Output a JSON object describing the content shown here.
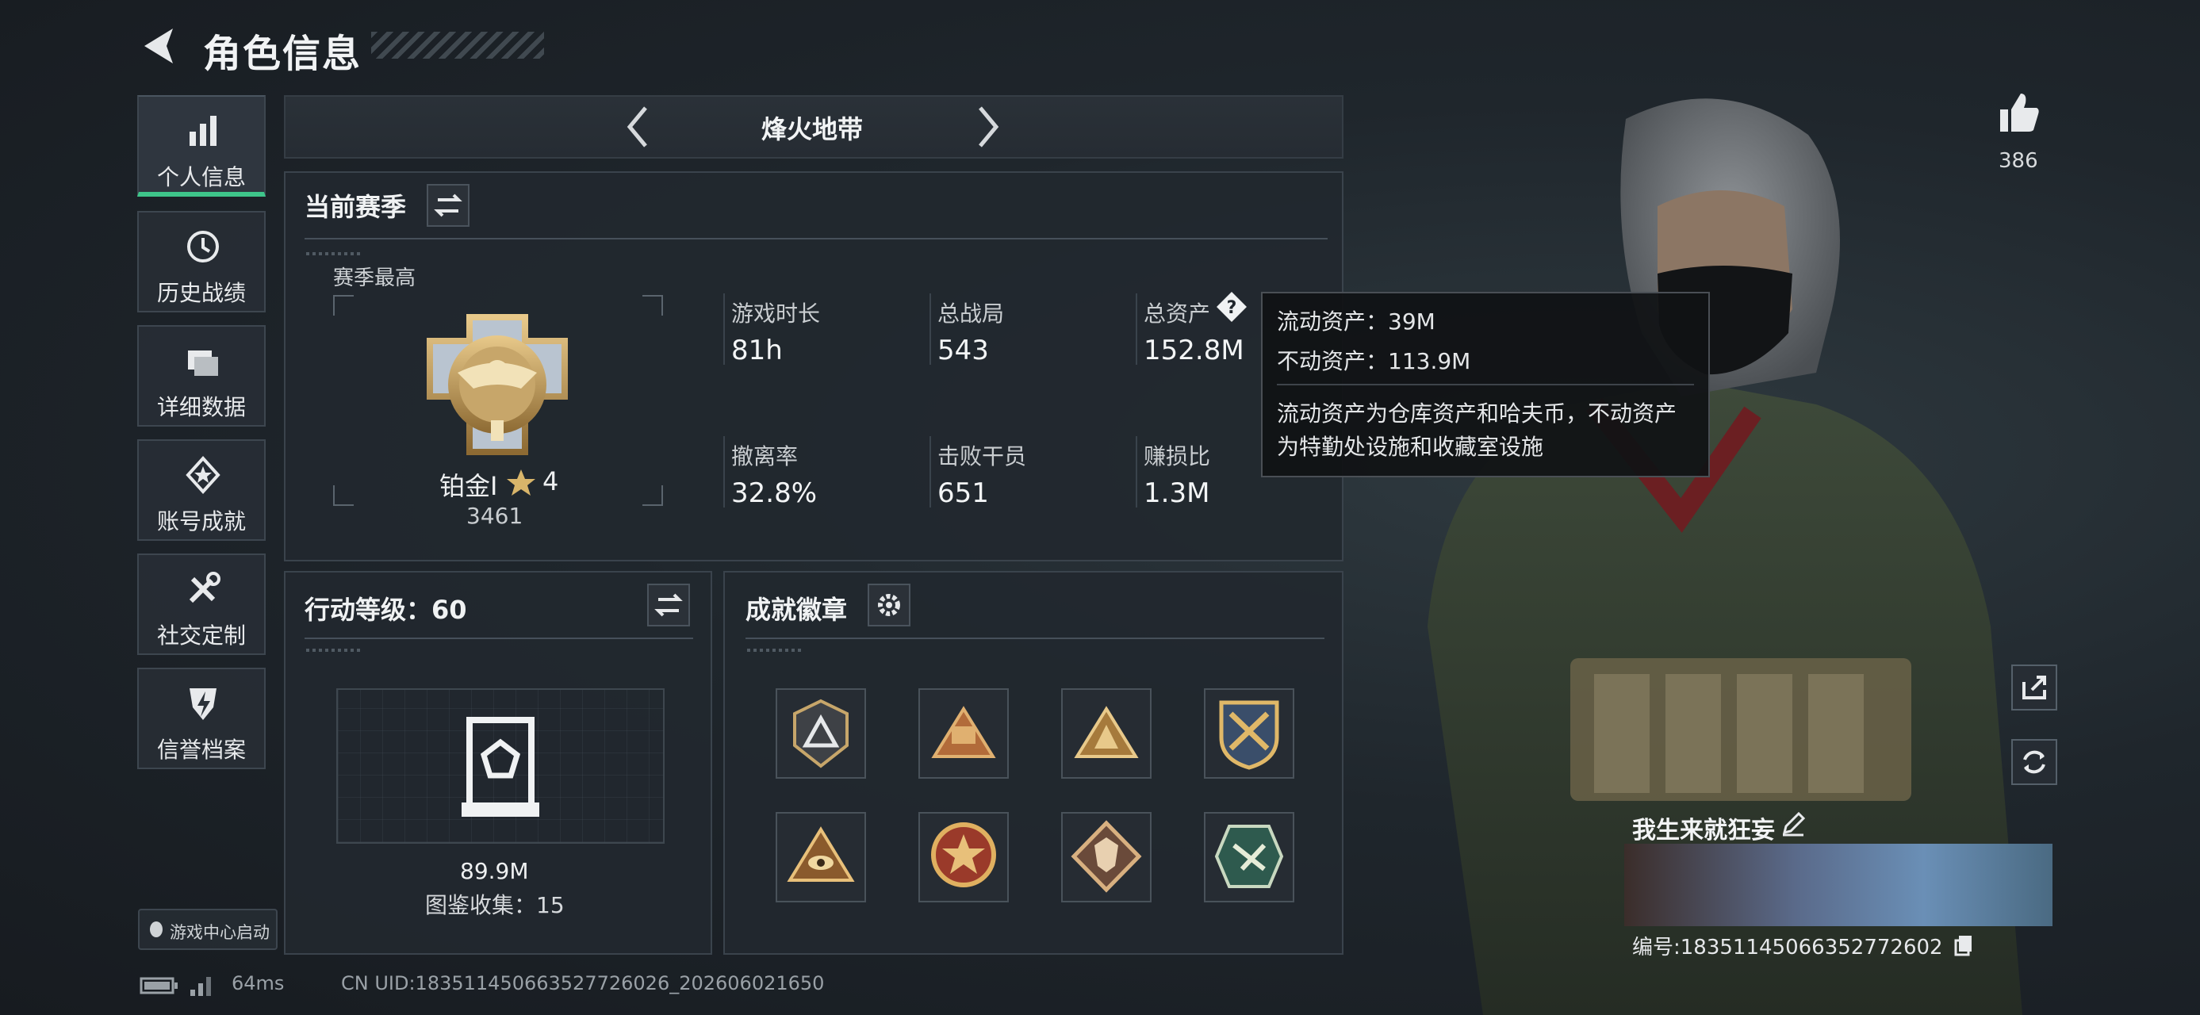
{
  "header": {
    "title": "角色信息"
  },
  "sidebar": {
    "items": [
      {
        "label": "个人信息",
        "icon": "bar-chart-icon"
      },
      {
        "label": "历史战绩",
        "icon": "history-icon"
      },
      {
        "label": "详细数据",
        "icon": "folder-icon"
      },
      {
        "label": "账号成就",
        "icon": "achievement-icon"
      },
      {
        "label": "社交定制",
        "icon": "tools-icon"
      },
      {
        "label": "信誉档案",
        "icon": "shield-icon"
      }
    ],
    "launcher_label": "游戏中心启动"
  },
  "mode": {
    "title": "烽火地带"
  },
  "season": {
    "title": "当前赛季",
    "best_label": "赛季最高",
    "rank_name": "铂金Ⅰ",
    "rank_stars": "4",
    "rank_points": "3461",
    "stats": [
      {
        "label": "游戏时长",
        "value": "81h"
      },
      {
        "label": "总战局",
        "value": "543"
      },
      {
        "label": "总资产",
        "value": "152.8M"
      },
      {
        "label": "撤离率",
        "value": "32.8%"
      },
      {
        "label": "击败干员",
        "value": "651"
      },
      {
        "label": "赚损比",
        "value": "1.3M"
      }
    ]
  },
  "tooltip": {
    "liquid": "流动资产：39M",
    "fixed": "不动资产：113.9M",
    "desc_line1": "流动资产为仓库资产和哈夫币，不动资产",
    "desc_line2": "为特勤处设施和收藏室设施"
  },
  "action_level": {
    "title": "行动等级：60",
    "value": "89.9M",
    "collection": "图鉴收集：15"
  },
  "achievements": {
    "title": "成就徽章",
    "badges": [
      "triangle-badge-icon",
      "winged-emblem-icon",
      "pyramid-badge-icon",
      "crossed-arms-badge-icon",
      "eye-triangle-badge-icon",
      "star-medal-icon",
      "wolf-badge-icon",
      "hornet-badge-icon"
    ]
  },
  "right": {
    "like_count": "386",
    "player_name": "我生来就狂妄",
    "player_id": "编号:18351145066352772602"
  },
  "footer": {
    "ping": "64ms",
    "uid": "CN UID:18351145066352772602​6_202606021650"
  },
  "colors": {
    "accent_green": "#3ec58a",
    "panel_bg": "#22282f"
  }
}
